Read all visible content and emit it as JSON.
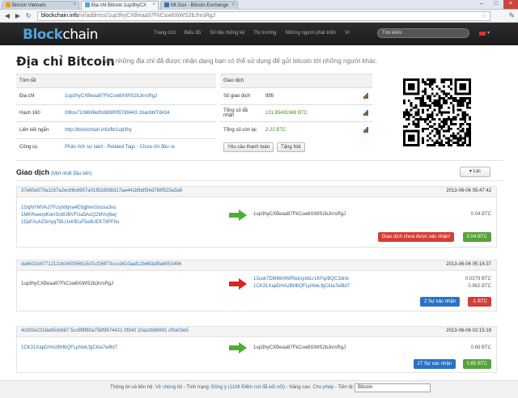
{
  "browser": {
    "tabs": [
      {
        "label": "Bitcoin Vietnam",
        "active": false
      },
      {
        "label": "Địa chỉ Bitcoin 1up3hyCX",
        "active": true
      },
      {
        "label": "Mt.Gox - Bitcoin Exchange",
        "active": false
      }
    ],
    "url_host": "blockchain.info",
    "url_path": "/vi/address/1up3hyCXBeaa97FkCsw8XiWS2bJnrsRgJ"
  },
  "nav": {
    "logo_a": "Block",
    "logo_b": "chain",
    "links": [
      "Trang chủ",
      "Biểu đồ",
      "Số liệu thống kê",
      "Thị trường",
      "Những người phát triển",
      "Ví"
    ],
    "search_placeholder": "Tìm kiếm"
  },
  "page": {
    "title": "Địa chỉ Bitcoin",
    "subtitle": "Với những địa chỉ đã được nhận dạng bạn có thể sử dụng để gửi bitcoin tới những người khác."
  },
  "summary": {
    "header": "Tóm tắt",
    "rows": [
      {
        "key": "Địa chỉ",
        "value": "1up3hyCXBeaa97FkCsw8XiWS2bJnrsRgJ"
      },
      {
        "key": "Hash 160",
        "value": "09fce7108696ef0d808f0f9789443 1bac6bf7d434"
      },
      {
        "key": "Liên kết ngắn",
        "value": "http://blockchain.info/fb/1up3hy"
      },
      {
        "key": "Công cụ",
        "value": "Phân tích sự taint - Related Tags - Chưa chi đầu ra"
      }
    ]
  },
  "transactions_summary": {
    "header": "Giao dịch",
    "rows": [
      {
        "key": "Số giao dịch",
        "value": "995"
      },
      {
        "key": "Tổng số đã nhận",
        "value": "131.95481969 BTC"
      },
      {
        "key": "Tổng số còn lại",
        "value": "2.22 BTC"
      }
    ],
    "btn_request": "Yêu cầu thanh toán",
    "btn_donate": "Tặng Nút"
  },
  "tx_section": {
    "title": "Giao dịch",
    "subtitle": "(Mới nhất đầu tiên)",
    "filter": "Lọc"
  },
  "transactions": [
    {
      "hash": "37e65e570a1167a2ec66c6957a01f82d088317aa441bfbdf34d788f523a3a6",
      "time": "2013-06-06 05:47:42",
      "inputs": [
        "1GqNYMVAJ7FUytxfqna4E9gjhesSossa3nu",
        "1MKRwwrpKwnSn8UBVFUa5AoQ2MVvj6wj",
        "1DpFAuhZ5myqTBUJxKfEuF5e8UEKT8FFho"
      ],
      "direction": "in",
      "outputs": [
        "1up3hyCXBeaa97FkCsw8XiWS2bJnrsRgJ"
      ],
      "amounts": [
        "0.04 BTC"
      ],
      "status_label": "Giao dịch chưa được xác nhận!",
      "status_type": "red",
      "total": "0.04 BTC",
      "total_type": "green"
    },
    {
      "hash": "da6631b8771212cb340056815cf1cf26ff73cccd410aaf12b463af9ab053496",
      "time": "2013-06-06 05:16:37",
      "inputs": [
        "1up3hyCXBeaa97FkCsw8XiWS2bJnrsRgJ"
      ],
      "direction": "out",
      "outputs": [
        "13usk7DM86HWPbuUyxbLr1KFqrBQC3dnb",
        "1CK31XapDHAzBHbQFLpNwLfgCkta7wBd7"
      ],
      "amounts": [
        "0.0379 BTC",
        "0.962 BTC"
      ],
      "status_label": "2 Sự xác nhận",
      "status_type": "blue",
      "total": "-1 BTC",
      "total_type": "red"
    },
    {
      "hash": "4c933e231ba65cb687 5cc8f8f80a75bf9674421 0f340 10a1d689691 cf0a03e5",
      "time": "2013-06-06 02:15:18",
      "inputs": [
        "1CK31XapDHAzBHbQFLpNwLfgCkta7wBd7"
      ],
      "direction": "in",
      "outputs": [
        "1up3hyCXBeaa97FkCsw8XiWS2bJnrsRgJ"
      ],
      "amounts": [
        "0.65 BTC"
      ],
      "status_label": "27 Sự xác nhận",
      "status_type": "blue",
      "total": "0.65 BTC",
      "total_type": "green"
    }
  ],
  "footer": {
    "t1": "Thông tin và liên hệ:",
    "l1": "Về chúng tôi",
    "t2": "- Tình trạng:",
    "l2": "Đồng ý (1108 Điểm nút đã kết nối)",
    "t3": "- Nâng cao:",
    "l3": "Cho phép",
    "t4": "- Tiền tệ:",
    "currency": "Bitcoin"
  },
  "colors": {
    "accent": "#2f6fa7",
    "green_arrow": "#4caf32",
    "red_arrow": "#d8261d",
    "navbar": "#1f1f1f"
  }
}
